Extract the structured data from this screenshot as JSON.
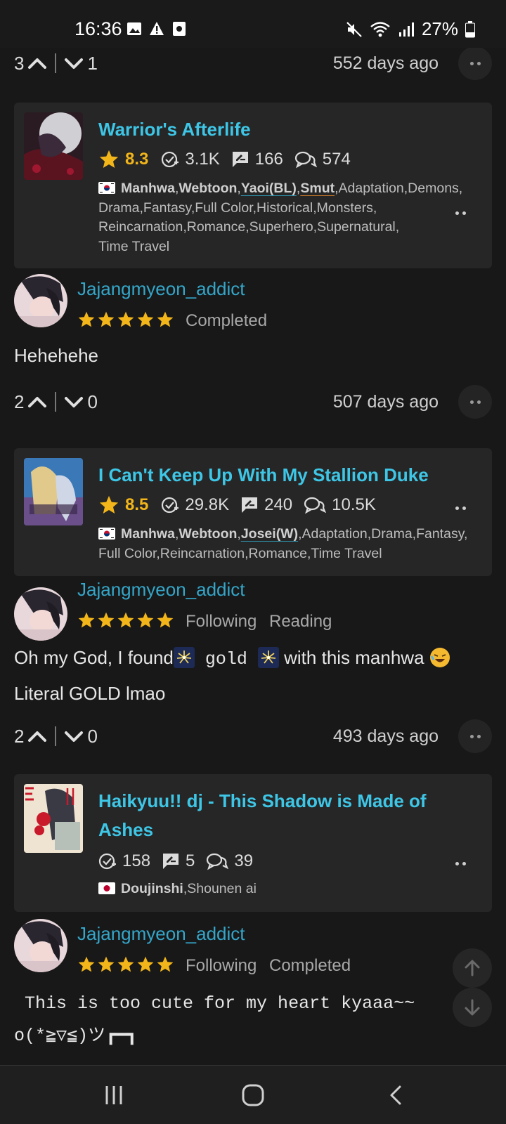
{
  "status_bar": {
    "time": "16:36",
    "battery": "27%"
  },
  "colors": {
    "accent": "#3ec6e6",
    "username": "#34a6c9",
    "rating": "#f2b51a",
    "background": "#181818",
    "card": "#262626"
  },
  "top_row": {
    "upvotes": "3",
    "downvotes": "1",
    "time": "552 days ago"
  },
  "entries": [
    {
      "manga": {
        "title": "Warrior's Afterlife",
        "rating": "8.3",
        "follows": "3.1K",
        "reviews": "166",
        "comments": "574",
        "origin_flag": "korea-flag",
        "tags_bold": [
          "Manhwa",
          "Webtoon",
          "Yaoi(BL)",
          "Smut"
        ],
        "tags_rest": "Adaptation,Demons,",
        "tags_line2": "Drama,Fantasy,Full Color,Historical,Monsters,",
        "tags_line3": "Reincarnation,Romance,Superhero,Supernatural,",
        "tags_line4": "Time Travel"
      },
      "review": {
        "username": "Jajangmyeon_addict",
        "status": [
          "Completed"
        ],
        "text": "Hehehehe",
        "upvotes": "2",
        "downvotes": "0",
        "time": "507 days ago"
      }
    },
    {
      "manga": {
        "title": "I Can't Keep Up With My Stallion Duke",
        "rating": "8.5",
        "follows": "29.8K",
        "reviews": "240",
        "comments": "10.5K",
        "origin_flag": "korea-flag",
        "tags_bold": [
          "Manhwa",
          "Webtoon",
          "Josei(W)"
        ],
        "tags_rest": "Adaptation,Drama,Fantasy,",
        "tags_line2": "Full Color,Reincarnation,Romance,Time Travel"
      },
      "review": {
        "username": "Jajangmyeon_addict",
        "status": [
          "Following",
          "Reading"
        ],
        "text_part1": "Oh my God, I found",
        "text_mono": " gold ",
        "text_part2": " with this manhwa ",
        "text_line2": "Literal GOLD lmao",
        "upvotes": "2",
        "downvotes": "0",
        "time": "493 days ago"
      }
    },
    {
      "manga": {
        "title_line1": "Haikyuu!! dj - This Shadow is Made of",
        "title_line2": "Ashes",
        "follows": "158",
        "reviews": "5",
        "comments": "39",
        "origin_flag": "japan-flag",
        "tags_bold": [
          "Doujinshi"
        ],
        "tags_rest": "Shounen ai"
      },
      "review": {
        "username": "Jajangmyeon_addict",
        "status": [
          "Following",
          "Completed"
        ],
        "text_line1": " This is too cute for my heart kyaaa~~",
        "text_line2": "o(*≧▽≦)ツ┏━┓"
      }
    }
  ]
}
